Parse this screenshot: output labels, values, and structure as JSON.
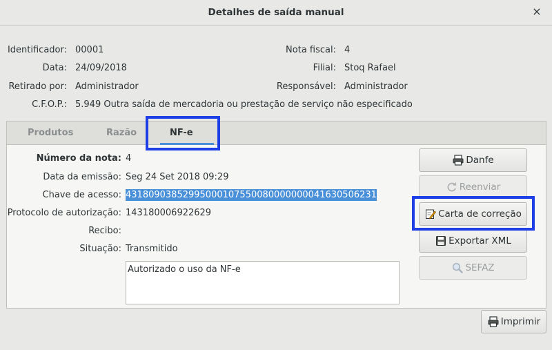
{
  "window": {
    "title": "Detalhes de saída manual",
    "close_glyph": "×"
  },
  "header": {
    "identificador": {
      "label": "Identificador:",
      "value": "00001"
    },
    "data": {
      "label": "Data:",
      "value": "24/09/2018"
    },
    "retirado_por": {
      "label": "Retirado por:",
      "value": "Administrador"
    },
    "cfop": {
      "label": "C.F.O.P.:",
      "value": "5.949 Outra saída de mercadoria ou prestação de serviço não especificado"
    },
    "nota_fiscal": {
      "label": "Nota fiscal:",
      "value": "4"
    },
    "filial": {
      "label": "Filial:",
      "value": "Stoq Rafael"
    },
    "responsavel": {
      "label": "Responsável:",
      "value": "Administrador"
    }
  },
  "tabs": [
    {
      "label": "Produtos",
      "active": false
    },
    {
      "label": "Razão",
      "active": false
    },
    {
      "label": "NF-e",
      "active": true
    }
  ],
  "nfe": {
    "numero": {
      "label": "Número da nota:",
      "value": "4"
    },
    "data_emissao": {
      "label": "Data da emissão:",
      "value": "Seg 24 Set 2018 09:29"
    },
    "chave": {
      "label": "Chave de acesso:",
      "value": "43180903852995000107550080000000041630506231"
    },
    "protocolo": {
      "label": "Protocolo de autorização:",
      "value": "143180006922629"
    },
    "recibo": {
      "label": "Recibo:",
      "value": ""
    },
    "situacao": {
      "label": "Situação:",
      "value": "Transmitido"
    },
    "mensagem": "Autorizado o uso da NF-e"
  },
  "buttons": {
    "danfe": {
      "label": "Danfe",
      "icon": "printer-icon",
      "enabled": true
    },
    "reenviar": {
      "label": "Reenviar",
      "icon": "refresh-icon",
      "enabled": false
    },
    "carta": {
      "label": "Carta de correção",
      "icon": "edit-note-icon",
      "enabled": true
    },
    "exportar": {
      "label": "Exportar XML",
      "icon": "save-icon",
      "enabled": true
    },
    "sefaz": {
      "label": "SEFAZ",
      "icon": "search-icon",
      "enabled": false
    },
    "imprimir": {
      "label": "Imprimir",
      "icon": "printer-icon",
      "enabled": true
    }
  },
  "colors": {
    "highlight_box": "#1f3fe6",
    "selection": "#4a90d9",
    "tab_underline": "#4a90d9"
  }
}
